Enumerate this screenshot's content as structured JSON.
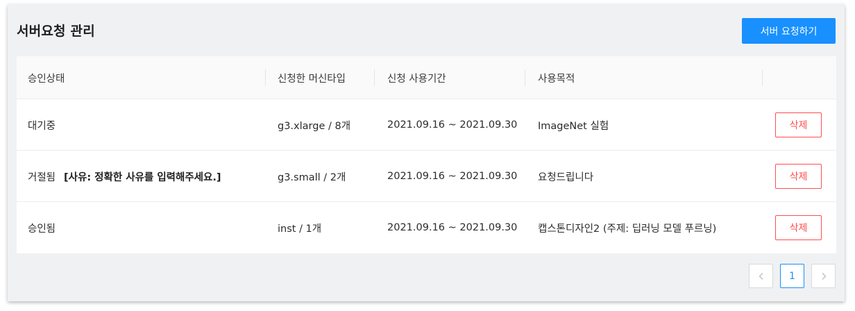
{
  "header": {
    "title": "서버요청 관리",
    "create_button": "서버 요청하기"
  },
  "table": {
    "columns": [
      "승인상태",
      "신청한 머신타입",
      "신청 사용기간",
      "사용목적",
      ""
    ],
    "rows": [
      {
        "status": "대기중",
        "reason": "",
        "machine": "g3.xlarge / 8개",
        "period": "2021.09.16 ~ 2021.09.30",
        "purpose": "ImageNet 실험",
        "action": "삭제"
      },
      {
        "status": "거절됨",
        "reason": "[사유: 정확한 사유를 입력해주세요.]",
        "machine": "g3.small / 2개",
        "period": "2021.09.16 ~ 2021.09.30",
        "purpose": "요청드립니다",
        "action": "삭제"
      },
      {
        "status": "승인됨",
        "reason": "",
        "machine": "inst / 1개",
        "period": "2021.09.16 ~ 2021.09.30",
        "purpose": "캡스톤디자인2 (주제: 딥러닝 모델 푸르닝)",
        "action": "삭제"
      }
    ]
  },
  "pagination": {
    "prev_icon": "chevron-left-icon",
    "current_page": "1",
    "next_icon": "chevron-right-icon"
  },
  "colors": {
    "primary": "#1890ff",
    "danger": "#ff4d4f",
    "panel_bg": "#f0f1f3"
  }
}
